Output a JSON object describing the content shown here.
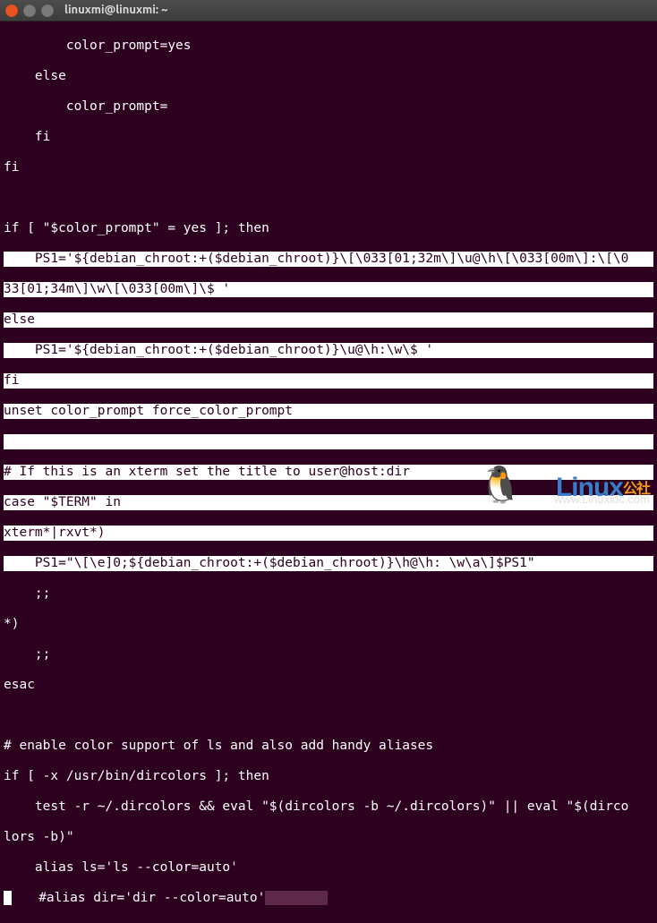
{
  "window": {
    "title": "linuxmi@linuxmi: ~"
  },
  "code": {
    "l01": "        color_prompt=yes",
    "l02": "    else",
    "l03": "        color_prompt=",
    "l04": "    fi",
    "l05": "fi",
    "l06": "",
    "l07_a": "if [ \"$color_prompt\" = yes ]; then",
    "l08_a": "    PS1='${debian_chroot:+($debian_chroot)}\\[\\033[01;32m\\]\\u@\\h\\[\\033[00m\\]:\\[\\0",
    "l09_a": "33[01;34m\\]\\w\\[\\033[00m\\]\\$ '",
    "l10_a": "else",
    "l11_a": "    PS1='${debian_chroot:+($debian_chroot)}\\u@\\h:\\w\\$ '",
    "l12_a": "fi",
    "l13_a": "unset color_prompt force_color_prompt",
    "l14_a": "",
    "l15_a": "# If this is an xterm set the title to user@host:dir",
    "l16_a": "case \"$TERM\" in",
    "l17_a": "xterm*|rxvt*)",
    "l18_a": "    PS1=\"\\[\\e]0;${debian_chroot:+($debian_chroot)}\\h@\\h: \\w\\a\\]$PS1\"",
    "l19": "    ;;",
    "l20": "*)",
    "l21": "    ;;",
    "l22": "esac",
    "l23": "",
    "l24": "# enable color support of ls and also add handy aliases",
    "l25": "if [ -x /usr/bin/dircolors ]; then",
    "l26": "    test -r ~/.dircolors && eval \"$(dircolors -b ~/.dircolors)\" || eval \"$(dirco",
    "l27": "lors -b)\"",
    "l28": "    alias ls='ls --color=auto'",
    "l29": "   #alias dir='dir --color=auto'"
  },
  "watermark": {
    "brand_l": "Linux",
    "brand_r": "公社",
    "url": "www.Linuxidc.com"
  }
}
